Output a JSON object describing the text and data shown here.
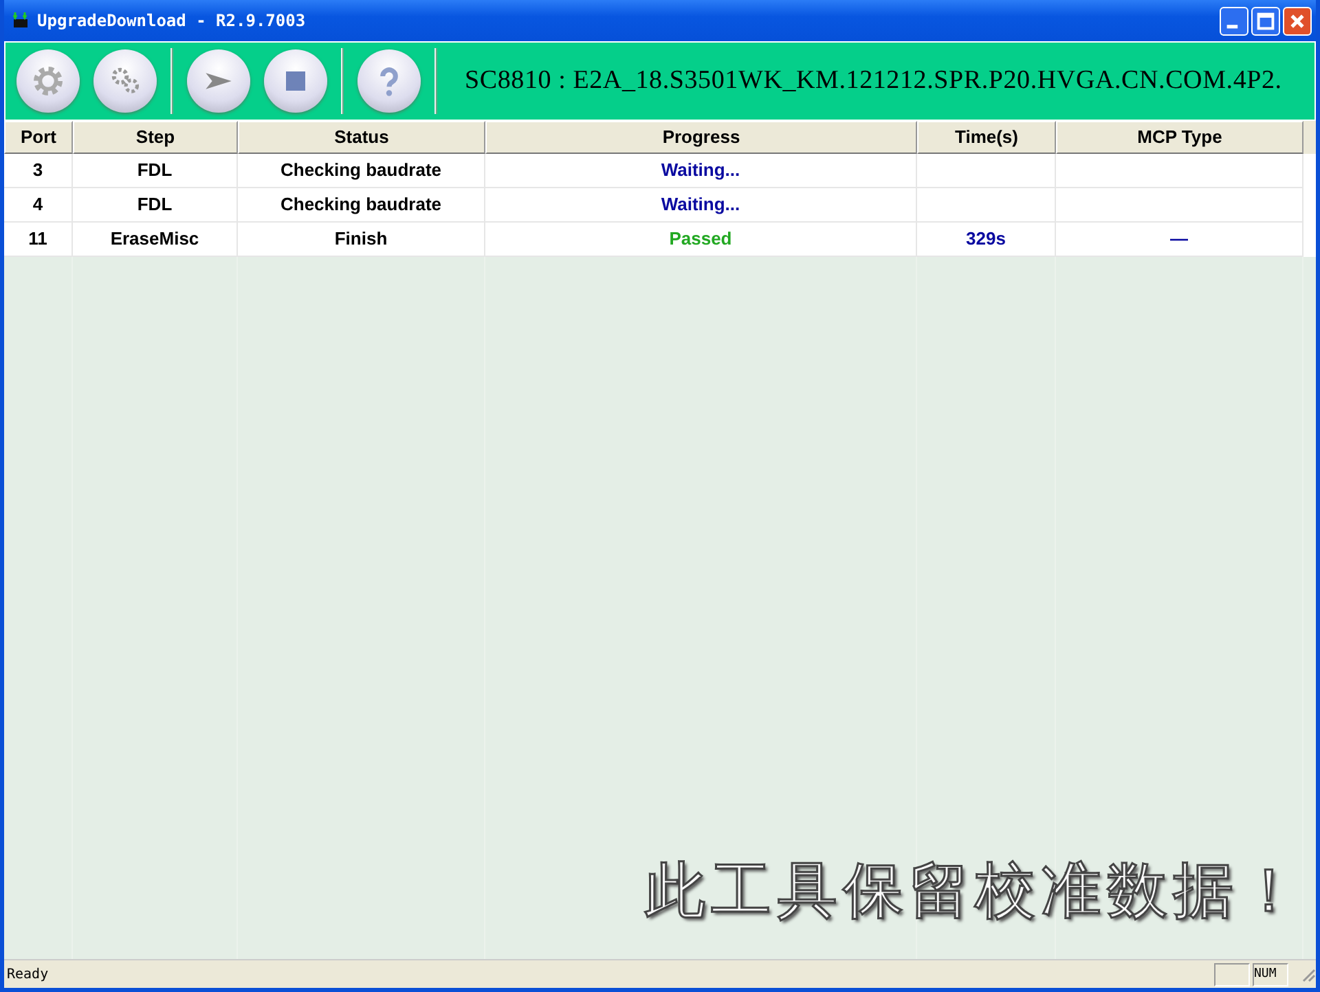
{
  "window": {
    "title": "UpgradeDownload - R2.9.7003"
  },
  "toolbar": {
    "buttons": [
      {
        "kind": "settings"
      },
      {
        "kind": "gears"
      },
      {
        "kind": "separator"
      },
      {
        "kind": "start"
      },
      {
        "kind": "stop"
      },
      {
        "kind": "separator"
      },
      {
        "kind": "help"
      },
      {
        "kind": "separator"
      }
    ],
    "product": "SC8810 : E2A_18.S3501WK_KM.121212.SPR.P20.HVGA.CN.COM.4P2."
  },
  "table": {
    "columns": [
      "Port",
      "Step",
      "Status",
      "Progress",
      "Time(s)",
      "MCP Type"
    ],
    "rows": [
      {
        "port": "3",
        "step": "FDL",
        "status": "Checking baudrate",
        "progress": {
          "text": "Waiting...",
          "kind": "waiting"
        },
        "time": "",
        "mcp_type": ""
      },
      {
        "port": "4",
        "step": "FDL",
        "status": "Checking baudrate",
        "progress": {
          "text": "Waiting...",
          "kind": "waiting"
        },
        "time": "",
        "mcp_type": ""
      },
      {
        "port": "11",
        "step": "EraseMisc",
        "status": "Finish",
        "progress": {
          "text": "Passed",
          "kind": "passed"
        },
        "time": "329s",
        "mcp_type": "—"
      }
    ]
  },
  "overlay_note": "此工具保留校准数据！",
  "status_bar": {
    "message": "Ready",
    "indicators": [
      "NUM"
    ]
  }
}
